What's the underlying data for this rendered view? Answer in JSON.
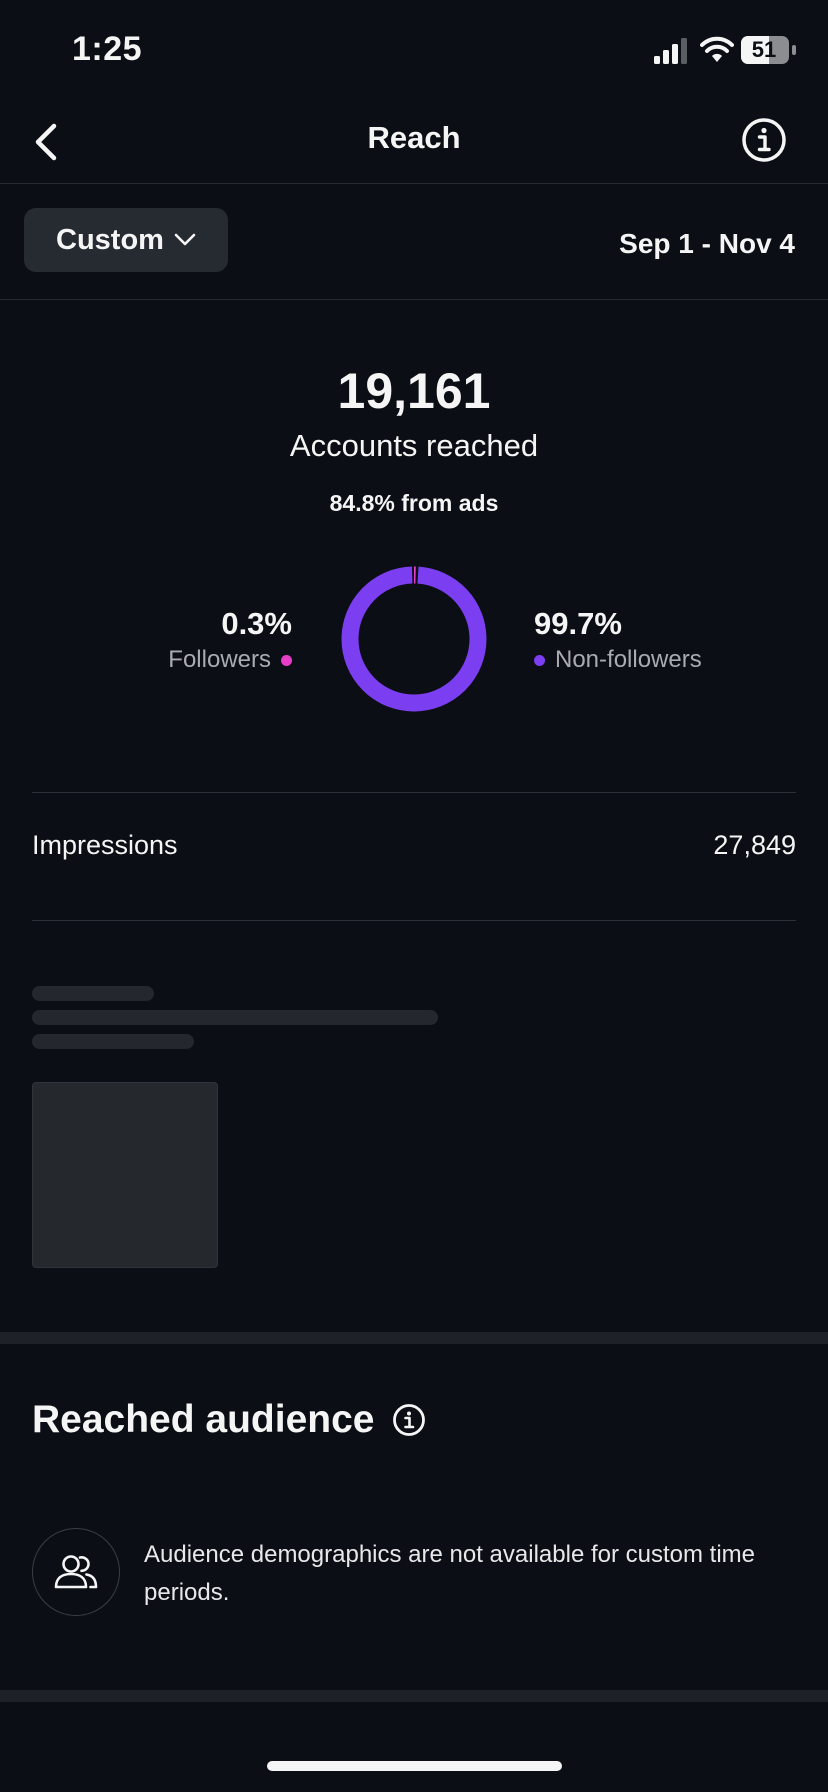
{
  "status_bar": {
    "time": "1:25",
    "battery": "51"
  },
  "header": {
    "title": "Reach"
  },
  "filter": {
    "period": "Custom",
    "date_range": "Sep 1 - Nov 4"
  },
  "summary": {
    "value": "19,161",
    "label": "Accounts reached",
    "ads_share": "84.8% from ads"
  },
  "breakdown": {
    "followers": {
      "value": "0.3%",
      "label": "Followers",
      "fraction": 0.003,
      "color": "#e63ec8"
    },
    "non_followers": {
      "value": "99.7%",
      "label": "Non-followers",
      "fraction": 0.997,
      "color": "#7b3ef0"
    }
  },
  "impressions": {
    "label": "Impressions",
    "value": "27,849"
  },
  "audience": {
    "title": "Reached audience",
    "message": "Audience demographics are not available for custom time periods."
  },
  "icons": [
    "back-arrow-icon",
    "info-icon",
    "chevron-down-icon",
    "people-icon",
    "signal-icon",
    "wifi-icon",
    "battery-icon"
  ]
}
